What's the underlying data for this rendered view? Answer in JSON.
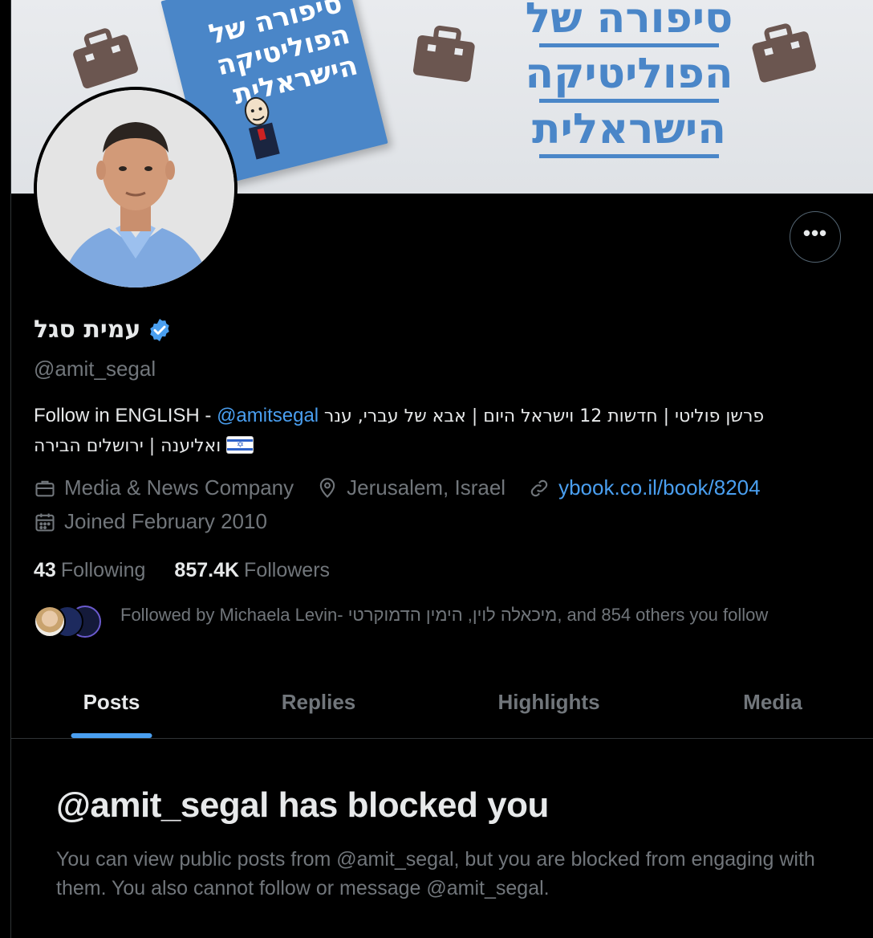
{
  "banner": {
    "book_title_lines": [
      "סיפורה של",
      "הפוליטיקה",
      "הישראלית"
    ],
    "banner_title_lines": [
      "סיפורה של",
      "הפוליטיקה",
      "הישראלית"
    ]
  },
  "profile": {
    "display_name": "עמית סגל",
    "handle": "@amit_segal",
    "verified": true,
    "more_label": "•••"
  },
  "bio": {
    "prefix": "Follow in ENGLISH - ",
    "mention": "@amitsegal",
    "hebrew_line1": "פרשן פוליטי | חדשות 12 וישראל היום | אבא של עברי, ענר",
    "hebrew_line2": "ואליענה | ירושלים הבירה"
  },
  "meta": {
    "category": "Media & News Company",
    "location": "Jerusalem, Israel",
    "website": "ybook.co.il/book/8204",
    "joined": "Joined February 2010"
  },
  "counts": {
    "following_value": "43",
    "following_label": "Following",
    "followers_value": "857.4K",
    "followers_label": "Followers"
  },
  "followed_by": {
    "text": "Followed by Michaela Levin- מיכאלה לוין, הימין הדמוקרטי, and 854 others you follow"
  },
  "tabs": [
    {
      "label": "Posts",
      "active": true
    },
    {
      "label": "Replies",
      "active": false
    },
    {
      "label": "Highlights",
      "active": false
    },
    {
      "label": "Media",
      "active": false
    }
  ],
  "blocked": {
    "title": "@amit_segal has blocked you",
    "message": "You can view public posts from @amit_segal, but you are blocked from engaging with them. You also cannot follow or message @amit_segal."
  },
  "colors": {
    "background": "#000000",
    "accent": "#4a9ff0",
    "muted": "#71767b",
    "text": "#e7e9ea",
    "banner_blue": "#4a86c8"
  }
}
